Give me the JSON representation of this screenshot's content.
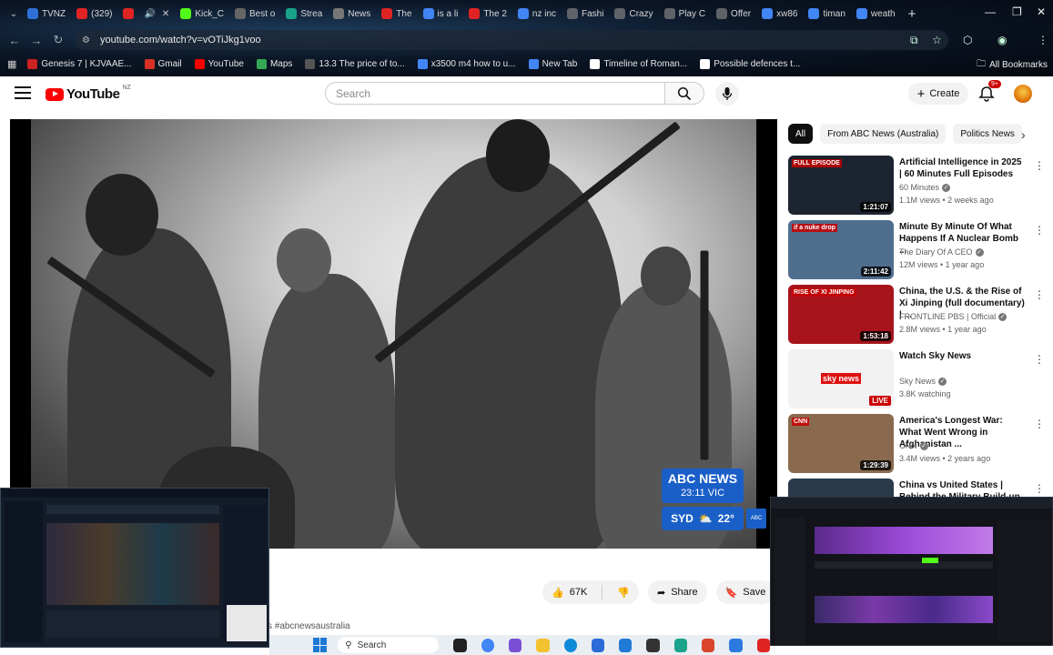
{
  "browser": {
    "tabs": [
      {
        "label": "TVNZ",
        "color": "#2f6fd8"
      },
      {
        "label": "(329)",
        "color": "#e02424"
      },
      {
        "label": "",
        "color": "#e02424"
      },
      {
        "label": "Kick_C",
        "color": "#53fc18"
      },
      {
        "label": "Best o",
        "color": "#666666"
      },
      {
        "label": "Strea",
        "color": "#19a38a"
      },
      {
        "label": "News",
        "color": "#777777"
      },
      {
        "label": "The",
        "color": "#e02424"
      },
      {
        "label": "is a li",
        "color": "#4285f4"
      },
      {
        "label": "The 2",
        "color": "#e02424"
      },
      {
        "label": "nz inc",
        "color": "#4285f4"
      },
      {
        "label": "Fashi",
        "color": "#5f6368"
      },
      {
        "label": "Crazy",
        "color": "#5f6368"
      },
      {
        "label": "Play C",
        "color": "#5f6368"
      },
      {
        "label": "Offer",
        "color": "#5f6368"
      },
      {
        "label": "xw86",
        "color": "#4285f4"
      },
      {
        "label": "timan",
        "color": "#4285f4"
      },
      {
        "label": "weath",
        "color": "#4285f4"
      }
    ],
    "url": "youtube.com/watch?v=vOTiJkg1voo",
    "bookmarks": [
      {
        "label": "Genesis 7 | KJVAAE...",
        "color": "#cc2222"
      },
      {
        "label": "Gmail",
        "color": "#d93025"
      },
      {
        "label": "YouTube",
        "color": "#ff0000"
      },
      {
        "label": "Maps",
        "color": "#34a853"
      },
      {
        "label": "13.3 The price of to...",
        "color": "#555555"
      },
      {
        "label": "x3500 m4 how to u...",
        "color": "#4285f4"
      },
      {
        "label": "New Tab",
        "color": "#4285f4"
      },
      {
        "label": "Timeline of Roman...",
        "color": "#ffffff"
      },
      {
        "label": "Possible defences t...",
        "color": "#ffffff"
      }
    ],
    "all_bookmarks": "All Bookmarks"
  },
  "youtube": {
    "logo": "YouTube",
    "region": "NZ",
    "search_placeholder": "Search",
    "create_label": "Create",
    "notif_count": "9+"
  },
  "player": {
    "news_brand": "ABC NEWS",
    "news_time": "23:11",
    "news_tz": "VIC",
    "city": "SYD",
    "temp": "22°"
  },
  "actions": {
    "likes": "67K",
    "share": "Share",
    "save": "Save",
    "hashtag": "s #abcnewsaustralia"
  },
  "chips": [
    "All",
    "From ABC News (Australia)",
    "Politics News"
  ],
  "recommendations": [
    {
      "title": "Artificial Intelligence in 2025 | 60 Minutes Full Episodes",
      "channel": "60 Minutes",
      "meta": "1.1M views • 2 weeks ago",
      "duration": "1:21:07",
      "thumb_text": "FULL EPISODE",
      "thumb_bg": "#1c2430"
    },
    {
      "title": "Minute By Minute Of What Happens If A Nuclear Bomb ...",
      "channel": "The Diary Of A CEO",
      "meta": "12M views • 1 year ago",
      "duration": "2:11:42",
      "thumb_text": "if a nuke drop",
      "thumb_bg": "#4f6e8e"
    },
    {
      "title": "China, the U.S. & the Rise of Xi Jinping (full documentary) | ...",
      "channel": "FRONTLINE PBS | Official",
      "meta": "2.8M views • 1 year ago",
      "duration": "1:53:18",
      "thumb_text": "RISE OF XI JINPING",
      "thumb_bg": "#a8141c"
    },
    {
      "title": "Watch Sky News",
      "channel": "Sky News",
      "meta": "3.8K watching",
      "duration": "LIVE",
      "thumb_text": "sky news",
      "thumb_bg": "#f2f2f2"
    },
    {
      "title": "America's Longest War: What Went Wrong in Afghanistan ...",
      "channel": "CNN",
      "meta": "3.4M views • 2 years ago",
      "duration": "1:29:39",
      "thumb_text": "CNN",
      "thumb_bg": "#8a6a4e"
    },
    {
      "title": "China vs United States | Behind the Military Build-up",
      "channel": "",
      "meta": "",
      "duration": "",
      "thumb_text": "",
      "thumb_bg": "#2a3a4a"
    }
  ],
  "taskbar": {
    "search": "Search"
  }
}
